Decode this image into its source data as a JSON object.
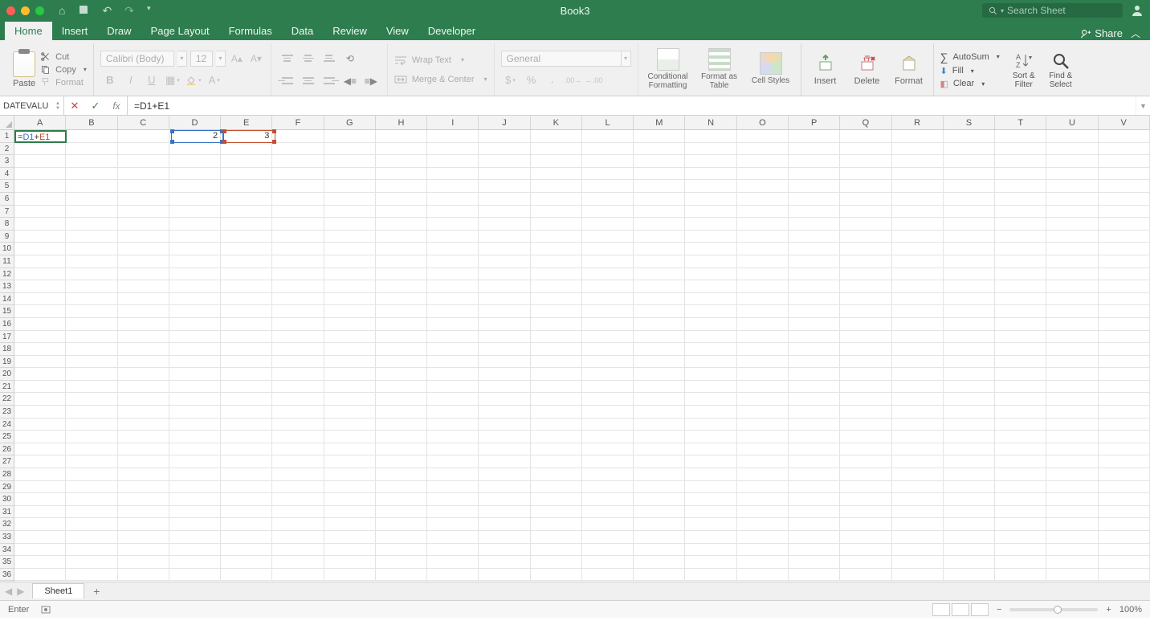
{
  "title": "Book3",
  "search_placeholder": "Search Sheet",
  "tabs": [
    "Home",
    "Insert",
    "Draw",
    "Page Layout",
    "Formulas",
    "Data",
    "Review",
    "View",
    "Developer"
  ],
  "active_tab": "Home",
  "share_label": "Share",
  "clipboard": {
    "paste": "Paste",
    "cut": "Cut",
    "copy": "Copy",
    "format": "Format"
  },
  "font": {
    "name": "Calibri (Body)",
    "size": "12"
  },
  "wrap": {
    "wrap_text": "Wrap Text",
    "merge_center": "Merge & Center"
  },
  "number_format": "General",
  "styles": {
    "conditional": "Conditional Formatting",
    "format_table": "Format as Table",
    "cell_styles": "Cell Styles"
  },
  "cells": {
    "insert": "Insert",
    "delete": "Delete",
    "format": "Format"
  },
  "editing": {
    "autosum": "AutoSum",
    "fill": "Fill",
    "clear": "Clear",
    "sort_filter": "Sort & Filter",
    "find_select": "Find & Select"
  },
  "name_box": "DATEVALU",
  "formula": "=D1+E1",
  "formula_parts": {
    "eq": "=",
    "ref1": "D1",
    "plus": "+",
    "ref2": "E1"
  },
  "columns": [
    "A",
    "B",
    "C",
    "D",
    "E",
    "F",
    "G",
    "H",
    "I",
    "J",
    "K",
    "L",
    "M",
    "N",
    "O",
    "P",
    "Q",
    "R",
    "S",
    "T",
    "U",
    "V"
  ],
  "row_count": 36,
  "cell_data": {
    "D1": "2",
    "E1": "3"
  },
  "sheet_name": "Sheet1",
  "status_mode": "Enter",
  "zoom": "100%"
}
